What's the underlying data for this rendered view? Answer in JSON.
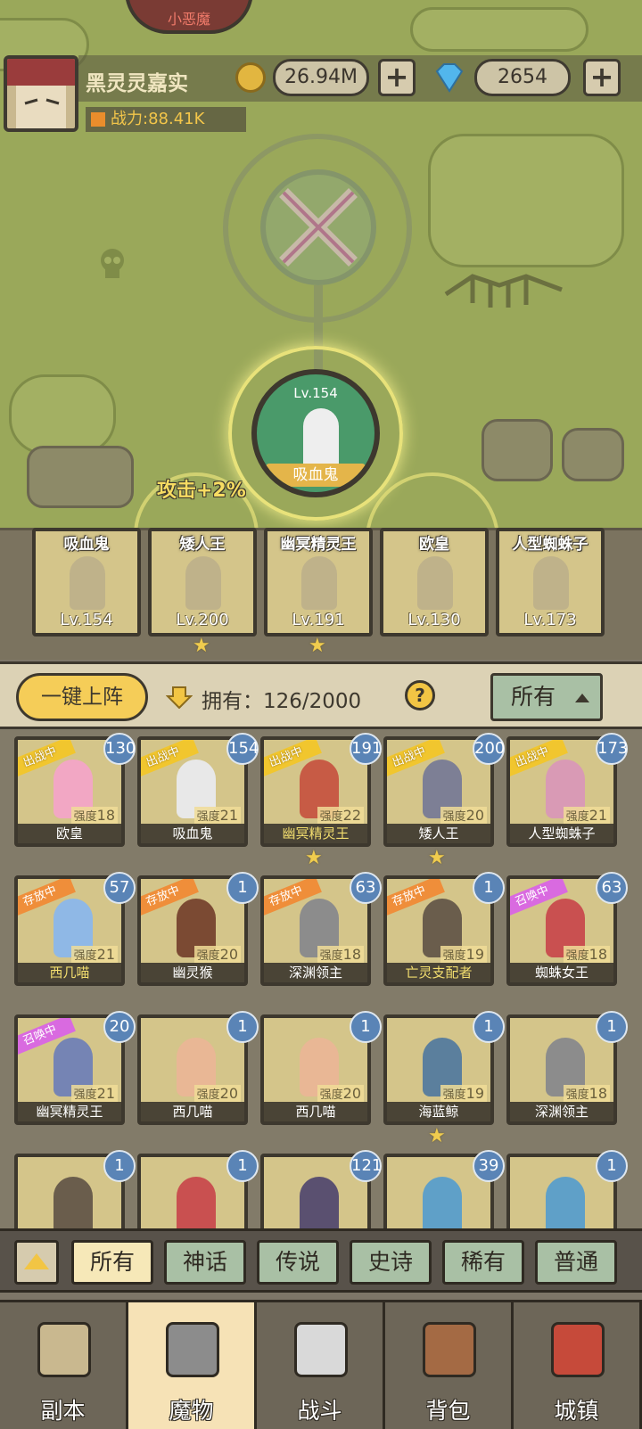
{
  "header": {
    "top_label": "小恶魔",
    "player_name": "黑灵灵嘉实",
    "gold": "26.94M",
    "gems": "2654",
    "power": "战力:88.41K",
    "plus": "+"
  },
  "map": {
    "featured": {
      "level": "Lv.154",
      "name": "吸血鬼"
    },
    "buff": "攻击+2%"
  },
  "lineup": [
    {
      "name": "吸血鬼",
      "level": "Lv.154",
      "star": ""
    },
    {
      "name": "矮人王",
      "level": "Lv.200",
      "star": "★"
    },
    {
      "name": "幽冥精灵王",
      "level": "Lv.191",
      "star": "★"
    },
    {
      "name": "欧皇",
      "level": "Lv.130",
      "star": ""
    },
    {
      "name": "人型蜘蛛子",
      "level": "Lv.173",
      "star": ""
    }
  ],
  "filter": {
    "auto_button": "一键上阵",
    "own_label": "拥有：126/2000",
    "help": "?",
    "dropdown": "所有"
  },
  "grid": [
    {
      "name": "欧皇",
      "level": "130",
      "tag": "出战中",
      "tagtype": "fight",
      "str_label": "强度",
      "str": "18",
      "star": "",
      "color": "#f2a7c4"
    },
    {
      "name": "吸血鬼",
      "level": "154",
      "tag": "出战中",
      "tagtype": "fight",
      "str_label": "强度",
      "str": "21",
      "star": "",
      "color": "#e8e8e8"
    },
    {
      "name": "幽冥精灵王",
      "level": "191",
      "tag": "出战中",
      "tagtype": "fight",
      "str_label": "强度",
      "str": "22",
      "star": "★",
      "color": "#c75b45",
      "gold": true
    },
    {
      "name": "矮人王",
      "level": "200",
      "tag": "出战中",
      "tagtype": "fight",
      "str_label": "强度",
      "str": "20",
      "star": "★",
      "color": "#7d7f95"
    },
    {
      "name": "人型蜘蛛子",
      "level": "173",
      "tag": "出战中",
      "tagtype": "fight",
      "str_label": "强度",
      "str": "21",
      "star": "",
      "color": "#d99ab5"
    },
    {
      "name": "西几喵",
      "level": "57",
      "tag": "存放中",
      "tagtype": "store",
      "str_label": "强度",
      "str": "21",
      "star": "",
      "color": "#8fb8e6",
      "gold": true
    },
    {
      "name": "幽灵猴",
      "level": "1",
      "tag": "存放中",
      "tagtype": "store",
      "str_label": "强度",
      "str": "20",
      "star": "",
      "color": "#7b4a33"
    },
    {
      "name": "深渊领主",
      "level": "63",
      "tag": "存放中",
      "tagtype": "store",
      "str_label": "强度",
      "str": "18",
      "star": "",
      "color": "#8c8c8c"
    },
    {
      "name": "亡灵支配者",
      "level": "1",
      "tag": "存放中",
      "tagtype": "store",
      "str_label": "强度",
      "str": "19",
      "star": "",
      "color": "#6a5d4c",
      "gold": true
    },
    {
      "name": "蜘蛛女王",
      "level": "63",
      "tag": "召唤中",
      "tagtype": "summon",
      "str_label": "强度",
      "str": "18",
      "star": "",
      "color": "#c95050"
    },
    {
      "name": "幽冥精灵王",
      "level": "20",
      "tag": "召唤中",
      "tagtype": "summon",
      "str_label": "强度",
      "str": "21",
      "star": "",
      "color": "#7584b4"
    },
    {
      "name": "西几喵",
      "level": "1",
      "tag": "",
      "tagtype": "",
      "str_label": "强度",
      "str": "20",
      "star": "",
      "color": "#e9b795"
    },
    {
      "name": "西几喵",
      "level": "1",
      "tag": "",
      "tagtype": "",
      "str_label": "强度",
      "str": "20",
      "star": "",
      "color": "#e9b795"
    },
    {
      "name": "海蓝鲸",
      "level": "1",
      "tag": "",
      "tagtype": "",
      "str_label": "强度",
      "str": "19",
      "star": "★",
      "color": "#5b7f9d"
    },
    {
      "name": "深渊领主",
      "level": "1",
      "tag": "",
      "tagtype": "",
      "str_label": "强度",
      "str": "18",
      "star": "",
      "color": "#8c8c8c"
    },
    {
      "name": "",
      "level": "1",
      "tag": "",
      "tagtype": "",
      "str_label": "",
      "str": "",
      "star": "",
      "color": "#6a5d4c"
    },
    {
      "name": "",
      "level": "1",
      "tag": "",
      "tagtype": "",
      "str_label": "",
      "str": "",
      "star": "",
      "color": "#c95050"
    },
    {
      "name": "",
      "level": "121",
      "tag": "",
      "tagtype": "",
      "str_label": "",
      "str": "",
      "star": "",
      "color": "#5a5070"
    },
    {
      "name": "",
      "level": "39",
      "tag": "",
      "tagtype": "",
      "str_label": "",
      "str": "",
      "star": "",
      "color": "#5fa0c8"
    },
    {
      "name": "",
      "level": "1",
      "tag": "",
      "tagtype": "",
      "str_label": "",
      "str": "",
      "star": "",
      "color": "#5fa0c8"
    }
  ],
  "rarity_tabs": [
    "所有",
    "神话",
    "传说",
    "史诗",
    "稀有",
    "普通"
  ],
  "nav": [
    "副本",
    "魔物",
    "战斗",
    "背包",
    "城镇"
  ],
  "colors": {
    "accent": "#f5cd58",
    "panel": "#dcd2b5",
    "tab": "#a9c0a5",
    "level_badge": "#5a84b6"
  }
}
